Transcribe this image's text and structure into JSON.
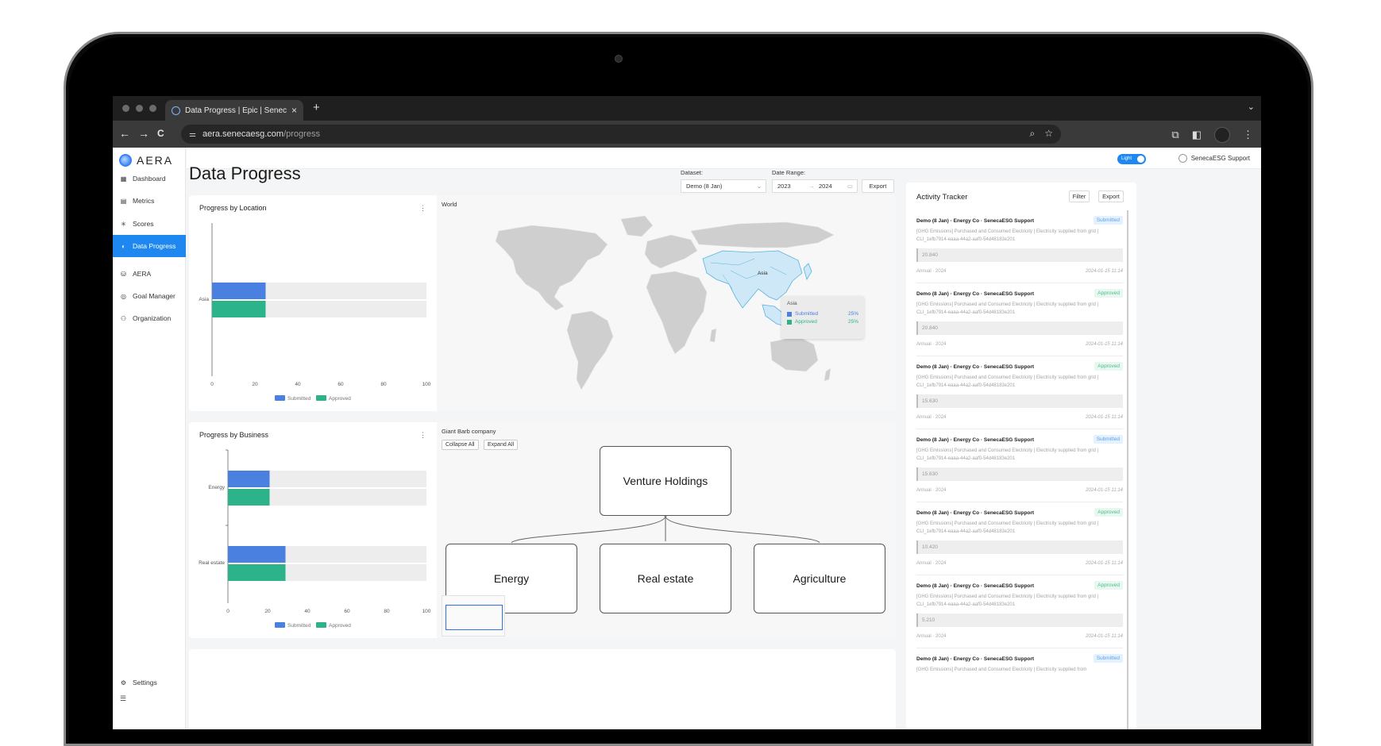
{
  "browser": {
    "tab_title": "Data Progress | Epic | Seneca",
    "tab_close": "×",
    "new_tab": "+",
    "tab_menu": "⌄",
    "back": "←",
    "forward": "→",
    "reload": "C",
    "url_domain": "aera.senecaesg.com",
    "url_path": "/progress",
    "url_icons": [
      "zoom-icon",
      "star-icon"
    ],
    "toolbar_icons": [
      "extensions-icon",
      "sidepanel-icon",
      "profile-icon",
      "menu-icon"
    ]
  },
  "app": {
    "logo_text": "AERA",
    "sidebar": [
      {
        "label": "Dashboard",
        "icon": "dashboard-icon",
        "glyph": "▦"
      },
      {
        "label": "Metrics",
        "icon": "metrics-icon",
        "glyph": "▤"
      },
      {
        "label": "Scores",
        "icon": "scores-icon",
        "glyph": "✳"
      },
      {
        "label": "Data Progress",
        "icon": "progress-icon",
        "glyph": "◐",
        "active": true
      },
      {
        "label": "AERA",
        "icon": "aera-icon",
        "glyph": "⛁"
      },
      {
        "label": "Goal Manager",
        "icon": "goal-icon",
        "glyph": "◎"
      },
      {
        "label": "Organization",
        "icon": "organization-icon",
        "glyph": "⚇"
      }
    ],
    "settings_label": "Settings",
    "theme_toggle_label": "Light",
    "user_name": "SenecaESG Support"
  },
  "header": {
    "title": "Data Progress",
    "dataset_label": "Dataset:",
    "dataset_value": "Demo (8 Jan)",
    "date_range_label": "Date Range:",
    "date_from": "2023",
    "date_arrow": "→",
    "date_to": "2024",
    "export_label": "Export"
  },
  "location_card": {
    "title": "Progress by Location",
    "map_title": "World",
    "tooltip": {
      "region": "Asia",
      "rows": [
        {
          "label": "Submitted",
          "value": "25%"
        },
        {
          "label": "Approved",
          "value": "25%"
        }
      ]
    },
    "map_label": "Asia"
  },
  "business_card": {
    "title": "Progress by Business",
    "tree_title": "Giant Barb company",
    "collapse_all": "Collapse All",
    "expand_all": "Expand All",
    "root_node": "Venture Holdings",
    "child_nodes": [
      "Energy",
      "Real estate",
      "Agriculture"
    ]
  },
  "chart_data": [
    {
      "type": "bar",
      "orientation": "horizontal",
      "title": "Progress by Location",
      "categories": [
        "Asia"
      ],
      "series": [
        {
          "name": "Submitted",
          "values": [
            25
          ]
        },
        {
          "name": "Approved",
          "values": [
            25
          ]
        }
      ],
      "xlim": [
        0,
        100
      ],
      "x_ticks": [
        "0",
        "20",
        "40",
        "60",
        "80",
        "100"
      ],
      "colors": {
        "Submitted": "#4a80e0",
        "Approved": "#2db38a"
      },
      "legend": "bottom"
    },
    {
      "type": "bar",
      "orientation": "horizontal",
      "title": "Progress by Business",
      "categories": [
        "Energy",
        "Real estate"
      ],
      "series": [
        {
          "name": "Submitted",
          "values": [
            21,
            29
          ]
        },
        {
          "name": "Approved",
          "values": [
            21,
            29
          ]
        }
      ],
      "xlim": [
        0,
        100
      ],
      "x_ticks": [
        "0",
        "20",
        "40",
        "60",
        "80",
        "100"
      ],
      "colors": {
        "Submitted": "#4a80e0",
        "Approved": "#2db38a"
      },
      "legend": "bottom"
    }
  ],
  "activity": {
    "title": "Activity Tracker",
    "filter_label": "Filter",
    "export_label": "Export",
    "items": [
      {
        "head": "Demo (8 Jan) · Energy Co · SenecaESG Support",
        "status": "Submitted",
        "desc": "[GHG Emissions] Purchased and Consumed Electricity | Electricity supplied from grid | CLI_1efb7914-eaaa-44a2-aaf0-54d48183e201",
        "value": "20.840",
        "period": "Annual · 2024",
        "time": "2024-01-15 11:14"
      },
      {
        "head": "Demo (8 Jan) · Energy Co · SenecaESG Support",
        "status": "Approved",
        "desc": "[GHG Emissions] Purchased and Consumed Electricity | Electricity supplied from grid | CLI_1efb7914-eaaa-44a2-aaf0-54d48183e201",
        "value": "20.840",
        "period": "Annual · 2024",
        "time": "2024-01-15 11:14"
      },
      {
        "head": "Demo (8 Jan) · Energy Co · SenecaESG Support",
        "status": "Approved",
        "desc": "[GHG Emissions] Purchased and Consumed Electricity | Electricity supplied from grid | CLI_1efb7914-eaaa-44a2-aaf0-54d48183e201",
        "value": "15.630",
        "period": "Annual · 2024",
        "time": "2024-01-15 11:14"
      },
      {
        "head": "Demo (8 Jan) · Energy Co · SenecaESG Support",
        "status": "Submitted",
        "desc": "[GHG Emissions] Purchased and Consumed Electricity | Electricity supplied from grid | CLI_1efb7914-eaaa-44a2-aaf0-54d48183e201",
        "value": "15.630",
        "period": "Annual · 2024",
        "time": "2024-01-15 11:14"
      },
      {
        "head": "Demo (8 Jan) · Energy Co · SenecaESG Support",
        "status": "Approved",
        "desc": "[GHG Emissions] Purchased and Consumed Electricity | Electricity supplied from grid | CLI_1efb7914-eaaa-44a2-aaf0-54d48183e201",
        "value": "10.420",
        "period": "Annual · 2024",
        "time": "2024-01-15 11:14"
      },
      {
        "head": "Demo (8 Jan) · Energy Co · SenecaESG Support",
        "status": "Approved",
        "desc": "[GHG Emissions] Purchased and Consumed Electricity | Electricity supplied from grid | CLI_1efb7914-eaaa-44a2-aaf0-54d48183e201",
        "value": "5.210",
        "period": "Annual · 2024",
        "time": "2024-01-15 11:14"
      },
      {
        "head": "Demo (8 Jan) · Energy Co · SenecaESG Support",
        "status": "Submitted",
        "desc": "[GHG Emissions] Purchased and Consumed Electricity | Electricity supplied from",
        "value": "",
        "period": "",
        "time": ""
      }
    ]
  }
}
